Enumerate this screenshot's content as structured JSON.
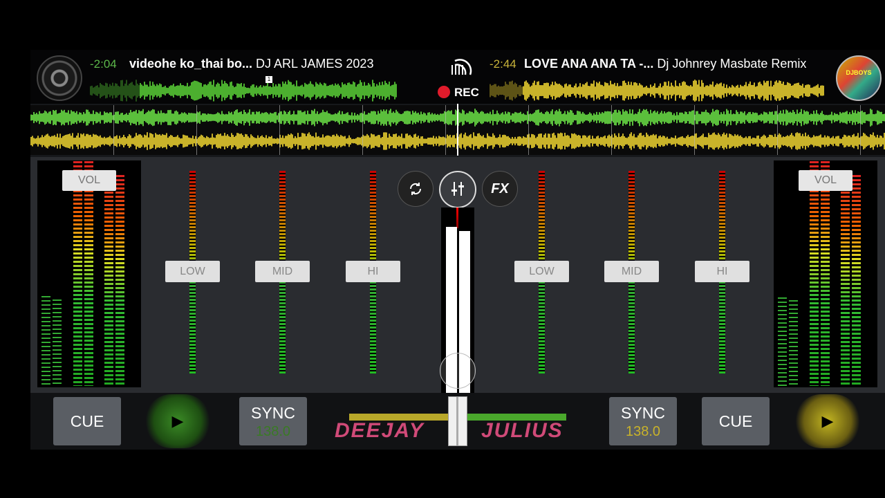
{
  "deck_left": {
    "time": "-2:04",
    "title_bold": "videohe ko_thai bo...",
    "artist": "DJ ARL JAMES 2023",
    "cue_label": "CUE",
    "sync_label": "SYNC",
    "bpm": "138.0",
    "wave_color": "#4caf2f",
    "avatar_icon": "vinyl-disc-icon",
    "cue_point": "1"
  },
  "deck_right": {
    "time": "-2:44",
    "title_bold": "LOVE ANA ANA TA -...",
    "artist": "Dj Johnrey Masbate Remix",
    "cue_label": "CUE",
    "sync_label": "SYNC",
    "bpm": "138.0",
    "wave_color": "#c9b32a",
    "avatar_icon": "album-art-icon",
    "avatar_text": "DJBOYS"
  },
  "header": {
    "rec_label": "REC"
  },
  "mixer": {
    "vol_label_left": "VOL",
    "vol_label_right": "VOL",
    "eq_labels_left": [
      "LOW",
      "MID",
      "HI"
    ],
    "eq_labels_right": [
      "LOW",
      "MID",
      "HI"
    ],
    "fx_label": "FX",
    "crossfader_position": 0.5
  },
  "background_text": {
    "left": "DEEJAY",
    "right": "JULIUS"
  },
  "colors": {
    "accent_left": "#4caf2f",
    "accent_right": "#c9b32a",
    "rec": "#e01b2b",
    "background_brand": "#d04a78"
  }
}
